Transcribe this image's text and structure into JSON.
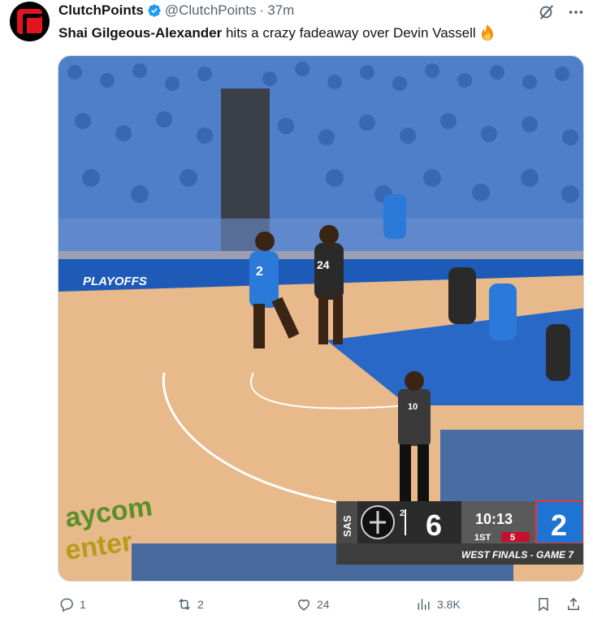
{
  "author": {
    "display_name": "ClutchPoints",
    "handle": "@ClutchPoints",
    "separator": "·",
    "timestamp": "37m",
    "verified": true
  },
  "tweet": {
    "mention_name": "Shai Gilgeous-Alexander",
    "text": " hits a crazy fadeaway over Devin Vassell",
    "emoji": "fire-emoji"
  },
  "media": {
    "court_banner": "PLAYOFFS",
    "floor_logo_line1": "aycom",
    "floor_logo_line2": "enter",
    "jerseys": {
      "sga": "2",
      "vassell": "24",
      "referee": "10"
    },
    "scoreboard": {
      "away_abbr": "SAS",
      "away_timeouts": "2",
      "away_score": "6",
      "game_clock": "10:13",
      "period": "1ST",
      "shot_clock": "5",
      "home_score": "2",
      "series_label": "WEST FINALS - GAME 7",
      "colors": {
        "home": "#1d74d2",
        "away": "#2b2b2b",
        "shot_clock": "#c8102e"
      }
    }
  },
  "actions": {
    "replies": "1",
    "reposts": "2",
    "likes": "24",
    "views": "3.8K"
  },
  "icons": [
    "grok-icon",
    "more-icon",
    "reply-icon",
    "repost-icon",
    "like-icon",
    "views-icon",
    "bookmark-icon",
    "share-icon"
  ],
  "colors": {
    "text": "#0f1419",
    "muted": "#536471",
    "verified": "#1d9bf0",
    "brand": "#e3141b"
  }
}
